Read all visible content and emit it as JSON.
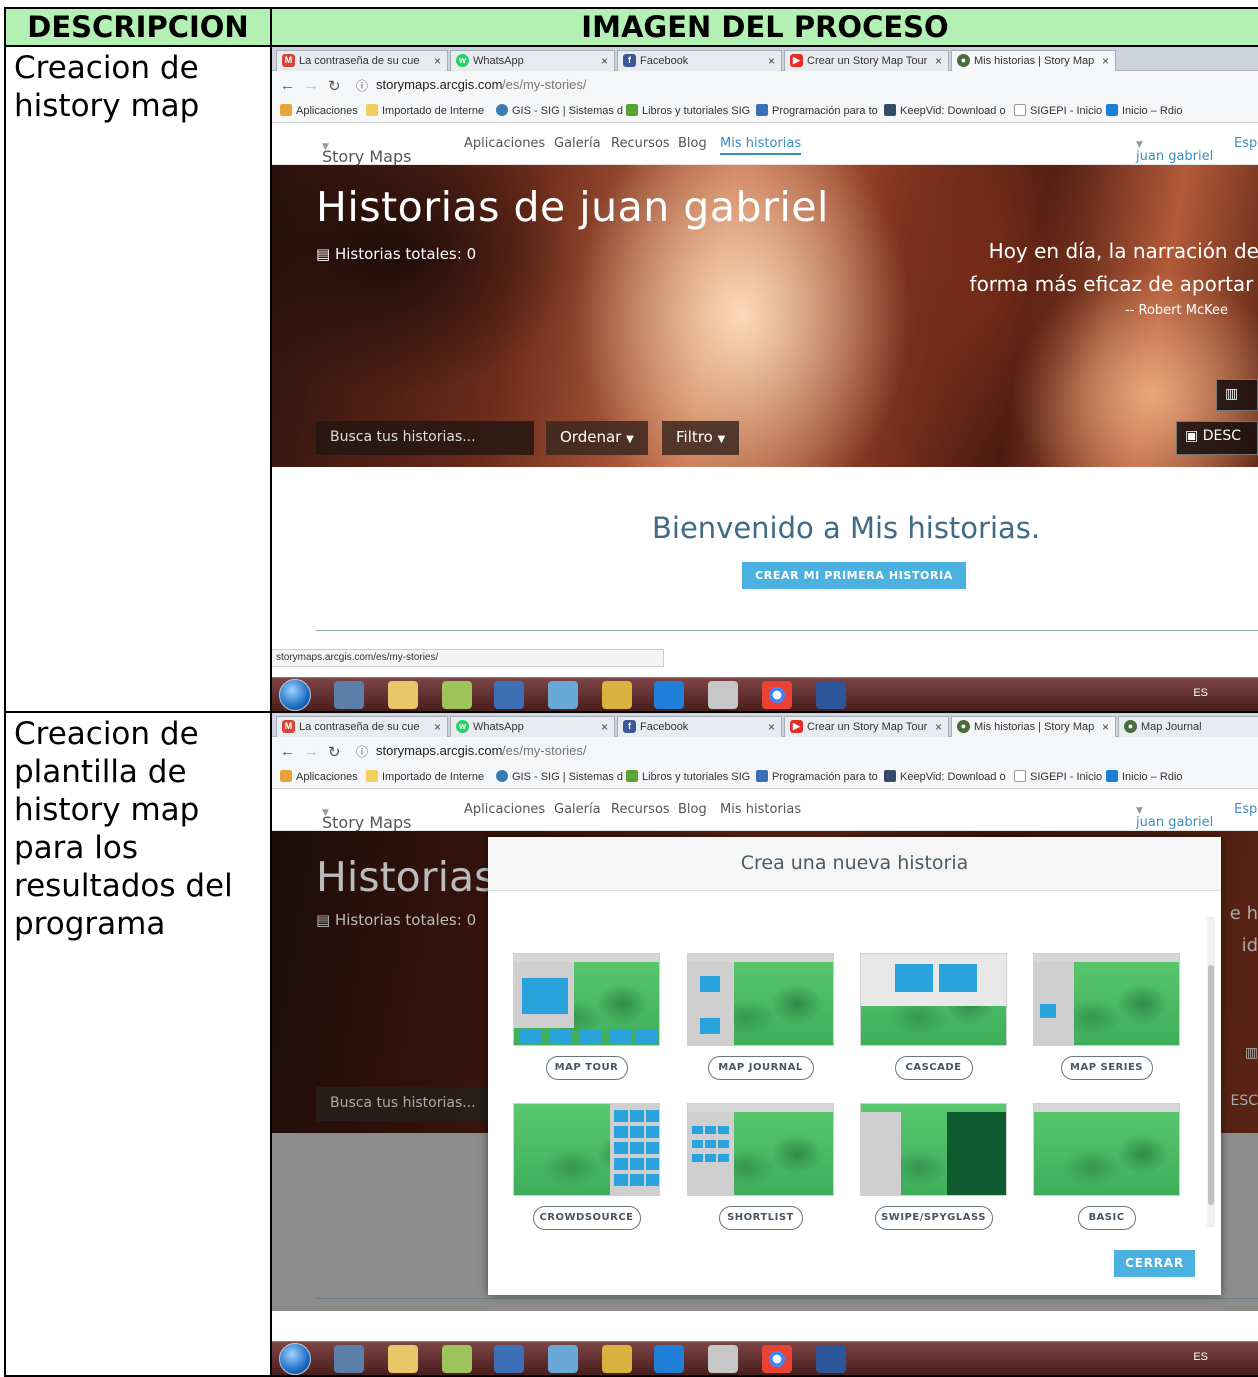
{
  "table": {
    "header_desc": "DESCRIPCION",
    "header_image": "IMAGEN DEL PROCESO",
    "rows": [
      {
        "description": "Creacion de history map"
      },
      {
        "description": "Creacion de plantilla de history map para los resultados del programa"
      }
    ]
  },
  "browser": {
    "tabs": [
      {
        "icon": "gmail-icon",
        "label": "La contraseña de su cue"
      },
      {
        "icon": "whatsapp-icon",
        "label": "WhatsApp"
      },
      {
        "icon": "facebook-icon",
        "label": "Facebook"
      },
      {
        "icon": "youtube-icon",
        "label": "Crear un Story Map Tour"
      },
      {
        "icon": "globe-icon",
        "label": "Mis historias | Story Map"
      },
      {
        "icon": "globe-icon",
        "label": "Map Journal"
      }
    ],
    "url_host": "storymaps.arcgis.com",
    "url_path": "/es/my-stories/",
    "bookmarks": [
      "Aplicaciones",
      "Importado de Interne",
      "GIS - SIG | Sistemas d",
      "Libros y tutoriales SIG",
      "Programación para to",
      "KeepVid: Download o",
      "SIGEPI - Inicio",
      "Inicio – Rdio"
    ],
    "status_url": "storymaps.arcgis.com/es/my-stories/"
  },
  "site": {
    "brand": "Story Maps",
    "nav": [
      "Aplicaciones",
      "Galería",
      "Recursos",
      "Blog",
      "Mis historias"
    ],
    "user": "juan gabriel",
    "lang_partial": "Esp"
  },
  "hero": {
    "title": "Historias de juan gabriel",
    "title_dimmed": "Historias",
    "total": "Historias totales: 0",
    "quote_line1": "Hoy en día, la narración de h",
    "quote_line2": "forma más eficaz de aportar id",
    "author": "-- Robert McKee",
    "search_placeholder": "Busca tus historias...",
    "sort": "Ordenar",
    "filter": "Filtro",
    "side_button": "DESC",
    "dim_edge_1": "e h",
    "dim_edge_2": "id",
    "dim_edge_3": "ESC"
  },
  "welcome": {
    "title": "Bienvenido a Mis historias.",
    "button": "CREAR MI PRIMERA HISTORIA"
  },
  "modal": {
    "title": "Crea una nueva historia",
    "templates": [
      "MAP TOUR",
      "MAP JOURNAL",
      "CASCADE",
      "MAP SERIES",
      "CROWDSOURCE",
      "SHORTLIST",
      "SWIPE/SPYGLASS",
      "BASIC"
    ],
    "close": "CERRAR"
  },
  "taskbar": {
    "lang": "ES"
  },
  "colors": {
    "header_bg": "#b3f0b3",
    "accent_blue": "#4cb1e1",
    "welcome_text": "#3f6b87"
  }
}
